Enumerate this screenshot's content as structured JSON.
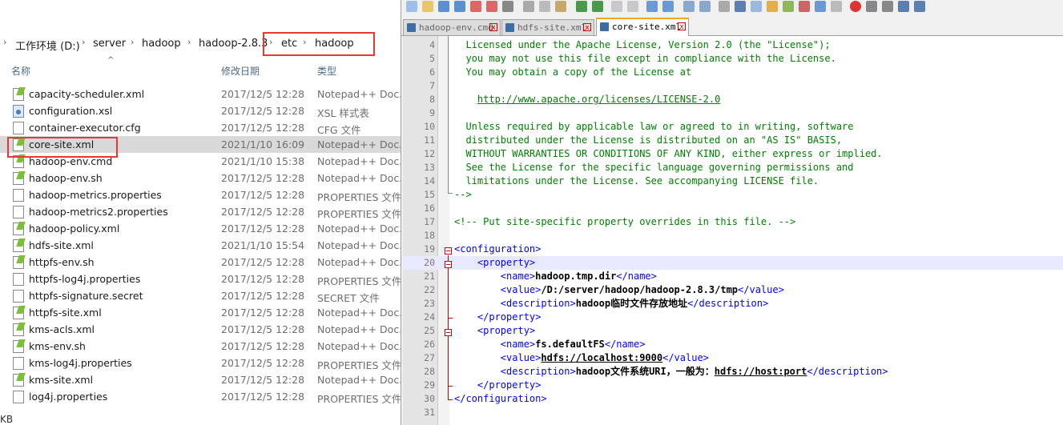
{
  "explorer": {
    "breadcrumb": [
      "工作环境 (D:)",
      "server",
      "hadoop",
      "hadoop-2.8.3",
      "etc",
      "hadoop"
    ],
    "columns": {
      "name": "名称",
      "date": "修改日期",
      "type": "类型"
    },
    "files": [
      {
        "name": "capacity-scheduler.xml",
        "date": "2017/12/5 12:28",
        "type": "Notepad++ Doc...",
        "icon": "notepadpp-doc-icon"
      },
      {
        "name": "configuration.xsl",
        "date": "2017/12/5 12:28",
        "type": "XSL 样式表",
        "icon": "xsl-file-icon"
      },
      {
        "name": "container-executor.cfg",
        "date": "2017/12/5 12:28",
        "type": "CFG 文件",
        "icon": "generic-file-icon"
      },
      {
        "name": "core-site.xml",
        "date": "2021/1/10 16:09",
        "type": "Notepad++ Doc...",
        "icon": "notepadpp-doc-icon",
        "selected": true
      },
      {
        "name": "hadoop-env.cmd",
        "date": "2021/1/10 15:38",
        "type": "Notepad++ Doc...",
        "icon": "notepadpp-doc-icon"
      },
      {
        "name": "hadoop-env.sh",
        "date": "2017/12/5 12:28",
        "type": "Notepad++ Doc...",
        "icon": "notepadpp-doc-icon"
      },
      {
        "name": "hadoop-metrics.properties",
        "date": "2017/12/5 12:28",
        "type": "PROPERTIES 文件",
        "icon": "generic-file-icon"
      },
      {
        "name": "hadoop-metrics2.properties",
        "date": "2017/12/5 12:28",
        "type": "PROPERTIES 文件",
        "icon": "generic-file-icon"
      },
      {
        "name": "hadoop-policy.xml",
        "date": "2017/12/5 12:28",
        "type": "Notepad++ Doc...",
        "icon": "notepadpp-doc-icon"
      },
      {
        "name": "hdfs-site.xml",
        "date": "2021/1/10 15:54",
        "type": "Notepad++ Doc...",
        "icon": "notepadpp-doc-icon"
      },
      {
        "name": "httpfs-env.sh",
        "date": "2017/12/5 12:28",
        "type": "Notepad++ Doc...",
        "icon": "notepadpp-doc-icon"
      },
      {
        "name": "httpfs-log4j.properties",
        "date": "2017/12/5 12:28",
        "type": "PROPERTIES 文件",
        "icon": "generic-file-icon"
      },
      {
        "name": "httpfs-signature.secret",
        "date": "2017/12/5 12:28",
        "type": "SECRET 文件",
        "icon": "generic-file-icon"
      },
      {
        "name": "httpfs-site.xml",
        "date": "2017/12/5 12:28",
        "type": "Notepad++ Doc...",
        "icon": "notepadpp-doc-icon"
      },
      {
        "name": "kms-acls.xml",
        "date": "2017/12/5 12:28",
        "type": "Notepad++ Doc...",
        "icon": "notepadpp-doc-icon"
      },
      {
        "name": "kms-env.sh",
        "date": "2017/12/5 12:28",
        "type": "Notepad++ Doc...",
        "icon": "notepadpp-doc-icon"
      },
      {
        "name": "kms-log4j.properties",
        "date": "2017/12/5 12:28",
        "type": "PROPERTIES 文件",
        "icon": "generic-file-icon"
      },
      {
        "name": "kms-site.xml",
        "date": "2017/12/5 12:28",
        "type": "Notepad++ Doc...",
        "icon": "notepadpp-doc-icon"
      },
      {
        "name": "log4j.properties",
        "date": "2017/12/5 12:28",
        "type": "PROPERTIES 文件",
        "icon": "generic-file-icon"
      }
    ],
    "status_fragment": "KB"
  },
  "notepad": {
    "tabs": [
      {
        "label": "hadoop-env.cmd",
        "active": false
      },
      {
        "label": "hdfs-site.xml",
        "active": false
      },
      {
        "label": "core-site.xml",
        "active": true
      }
    ],
    "current_line": 20,
    "lines": [
      {
        "n": 4,
        "parts": [
          {
            "t": "  Licensed under the Apache License, Version 2.0 (the \"License\");",
            "c": "comment"
          }
        ]
      },
      {
        "n": 5,
        "parts": [
          {
            "t": "  you may not use this file except in compliance with the License.",
            "c": "comment"
          }
        ]
      },
      {
        "n": 6,
        "parts": [
          {
            "t": "  You may obtain a copy of the License at",
            "c": "comment"
          }
        ]
      },
      {
        "n": 7,
        "parts": []
      },
      {
        "n": 8,
        "parts": [
          {
            "t": "    ",
            "c": "comment"
          },
          {
            "t": "http://www.apache.org/licenses/LICENSE-2.0",
            "c": "link"
          }
        ]
      },
      {
        "n": 9,
        "parts": []
      },
      {
        "n": 10,
        "parts": [
          {
            "t": "  Unless required by applicable law or agreed to in writing, software",
            "c": "comment"
          }
        ]
      },
      {
        "n": 11,
        "parts": [
          {
            "t": "  distributed under the License is distributed on an \"AS IS\" BASIS,",
            "c": "comment"
          }
        ]
      },
      {
        "n": 12,
        "parts": [
          {
            "t": "  WITHOUT WARRANTIES OR CONDITIONS OF ANY KIND, either express or implied.",
            "c": "comment"
          }
        ]
      },
      {
        "n": 13,
        "parts": [
          {
            "t": "  See the License for the specific language governing permissions and",
            "c": "comment"
          }
        ]
      },
      {
        "n": 14,
        "parts": [
          {
            "t": "  limitations under the License. See accompanying LICENSE file.",
            "c": "comment"
          }
        ]
      },
      {
        "n": 15,
        "parts": [
          {
            "t": "-->",
            "c": "comment"
          }
        ]
      },
      {
        "n": 16,
        "parts": []
      },
      {
        "n": 17,
        "parts": [
          {
            "t": "<!-- Put site-specific property overrides in this file. -->",
            "c": "comment"
          }
        ]
      },
      {
        "n": 18,
        "parts": []
      },
      {
        "n": 19,
        "parts": [
          {
            "t": "<configuration>",
            "c": "tag"
          }
        ]
      },
      {
        "n": 20,
        "parts": [
          {
            "t": "    <property>",
            "c": "tag"
          }
        ]
      },
      {
        "n": 21,
        "parts": [
          {
            "t": "        <name>",
            "c": "tag"
          },
          {
            "t": "hadoop.tmp.dir",
            "c": "text"
          },
          {
            "t": "</name>",
            "c": "tag"
          }
        ]
      },
      {
        "n": 22,
        "parts": [
          {
            "t": "        <value>",
            "c": "tag"
          },
          {
            "t": "/D:/server/hadoop/hadoop-2.8.3/tmp",
            "c": "text"
          },
          {
            "t": "</value>",
            "c": "tag"
          }
        ]
      },
      {
        "n": 23,
        "parts": [
          {
            "t": "        <description>",
            "c": "tag"
          },
          {
            "t": "hadoop临时文件存放地址",
            "c": "bold"
          },
          {
            "t": "</description>",
            "c": "tag"
          }
        ]
      },
      {
        "n": 24,
        "parts": [
          {
            "t": "    </property>",
            "c": "tag"
          }
        ]
      },
      {
        "n": 25,
        "parts": [
          {
            "t": "    <property>",
            "c": "tag"
          }
        ]
      },
      {
        "n": 26,
        "parts": [
          {
            "t": "        <name>",
            "c": "tag"
          },
          {
            "t": "fs.defaultFS",
            "c": "text"
          },
          {
            "t": "</name>",
            "c": "tag"
          }
        ]
      },
      {
        "n": 27,
        "parts": [
          {
            "t": "        <value>",
            "c": "tag"
          },
          {
            "t": "hdfs://localhost:9000",
            "c": "linkblack"
          },
          {
            "t": "</value>",
            "c": "tag"
          }
        ]
      },
      {
        "n": 28,
        "parts": [
          {
            "t": "        <description>",
            "c": "tag"
          },
          {
            "t": "hadoop文件系统URI，一般为：",
            "c": "bold"
          },
          {
            "t": "hdfs://host:port",
            "c": "linkblack"
          },
          {
            "t": "</description>",
            "c": "tag"
          }
        ]
      },
      {
        "n": 29,
        "parts": [
          {
            "t": "    </property>",
            "c": "tag"
          }
        ]
      },
      {
        "n": 30,
        "parts": [
          {
            "t": "</configuration>",
            "c": "tag"
          }
        ]
      },
      {
        "n": 31,
        "parts": []
      }
    ]
  },
  "colors": {
    "highlight_box": "#e53935",
    "comment": "#008000",
    "tag": "#0000ff",
    "current_line_bg": "#e8e8ff",
    "selected_row_bg": "#d9d9d9"
  }
}
